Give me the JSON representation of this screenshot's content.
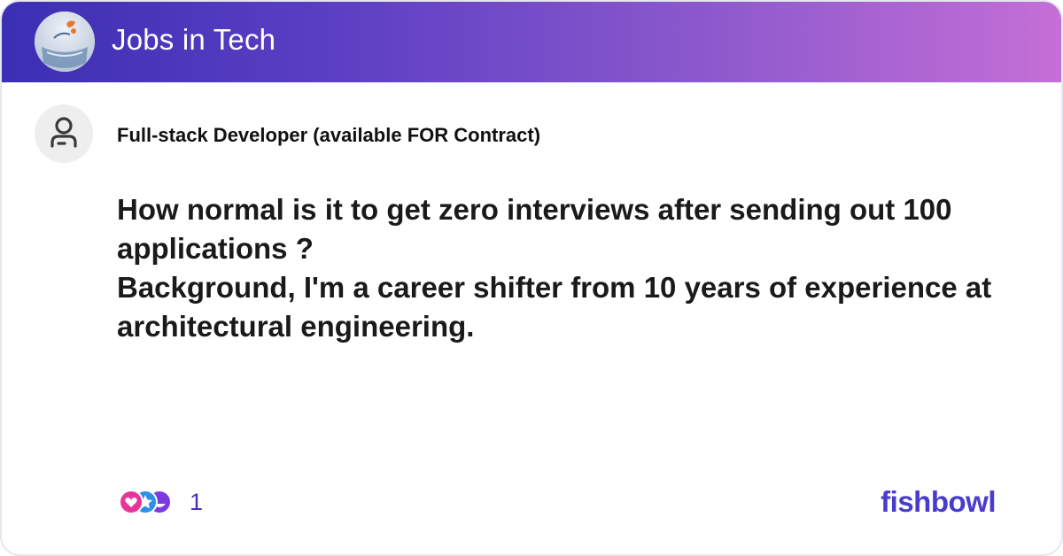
{
  "header": {
    "title": "Jobs in Tech",
    "bowl_icon": "bowl-avatar-icon"
  },
  "post": {
    "author_icon": "user-icon",
    "author": "Full-stack Developer (available FOR Contract)",
    "body_lines": [
      "How normal is it to get zero interviews after sending out 100",
      "applications ?",
      "Background, I'm a career shifter from 10 years of experience at",
      "architectural engineering."
    ]
  },
  "footer": {
    "reaction_icons": [
      "heart-reaction-icon",
      "star-reaction-icon",
      "laugh-reaction-icon"
    ],
    "reaction_count": "1",
    "brand": "fishbowl"
  },
  "colors": {
    "header_gradient_start": "#3b2fb3",
    "header_gradient_end": "#c56fd6",
    "brand": "#4a3bd0",
    "reaction_count": "#4433b8"
  }
}
